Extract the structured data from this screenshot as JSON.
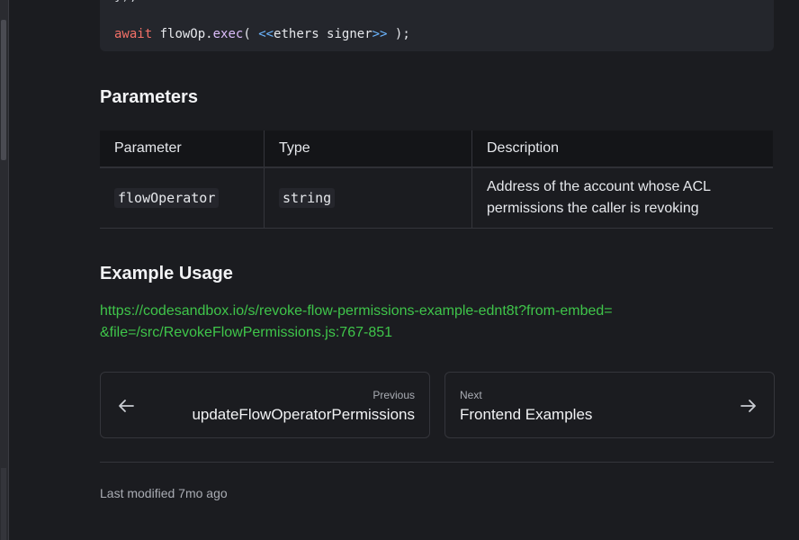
{
  "code": {
    "top_partial": "});",
    "await_kw": "await",
    "obj": "flowOp",
    "dot": ".",
    "method": "exec",
    "open": "( ",
    "lt": "<<",
    "arg": "ethers signer",
    "gt": ">>",
    "close": " );"
  },
  "parameters": {
    "heading": "Parameters",
    "columns": [
      "Parameter",
      "Type",
      "Description"
    ],
    "rows": [
      {
        "parameter": "flowOperator",
        "type": "string",
        "description": "Address of the account whose ACL permissions the caller is revoking"
      }
    ]
  },
  "usage": {
    "heading": "Example Usage",
    "link": "https://codesandbox.io/s/revoke-flow-permissions-example-ednt8t?from-embed=&file=/src/RevokeFlowPermissions.js:767-851"
  },
  "nav": {
    "prev_small": "Previous",
    "prev_title": "updateFlowOperatorPermissions",
    "next_small": "Next",
    "next_title": "Frontend Examples"
  },
  "footer": {
    "last_modified": "Last modified 7mo ago"
  },
  "colors": {
    "link": "#3fc54a",
    "keyword": "#f47067",
    "method": "#dcbdfb",
    "operator": "#6cb6ff"
  }
}
